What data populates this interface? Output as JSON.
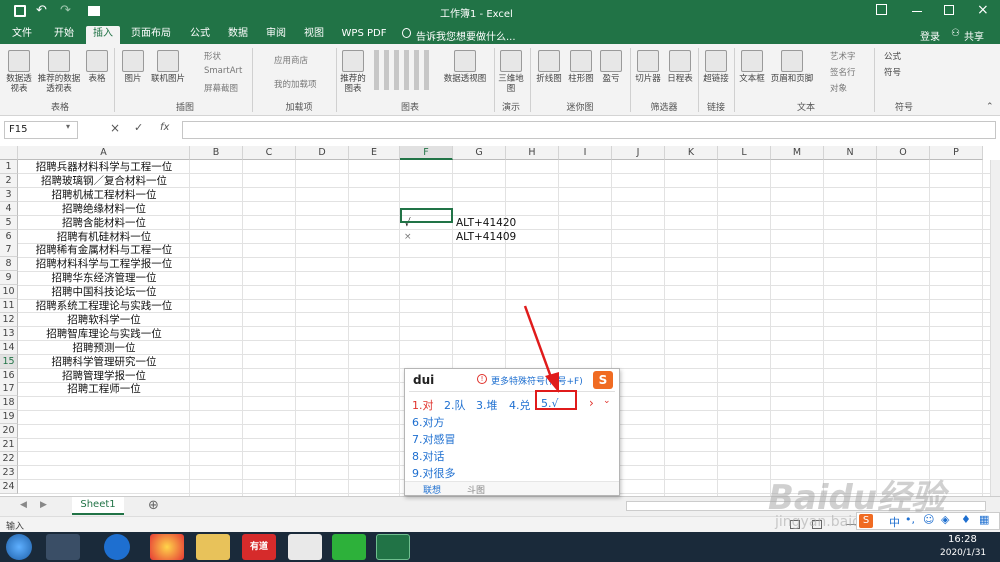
{
  "window": {
    "title": "工作簿1 - Excel"
  },
  "tabs": [
    "文件",
    "开始",
    "插入",
    "页面布局",
    "公式",
    "数据",
    "审阅",
    "视图",
    "WPS PDF"
  ],
  "active_tab": "插入",
  "tellme": "告诉我您想要做什么...",
  "account": {
    "login": "登录",
    "share": "共享"
  },
  "ribbon": {
    "groups": [
      {
        "label": "表格",
        "buttons": [
          "数据透视表",
          "推荐的数据透视表",
          "表格"
        ]
      },
      {
        "label": "插图",
        "buttons": [
          "图片",
          "联机图片"
        ],
        "small": [
          "形状",
          "SmartArt",
          "屏幕截图"
        ]
      },
      {
        "label": "加载项",
        "small": [
          "应用商店",
          "我的加载项"
        ]
      },
      {
        "label": "图表",
        "buttons": [
          "推荐的图表",
          "数据透视图"
        ]
      },
      {
        "label": "演示",
        "buttons": [
          "三维地图"
        ]
      },
      {
        "label": "迷你图",
        "buttons": [
          "折线图",
          "柱形图",
          "盈亏"
        ]
      },
      {
        "label": "筛选器",
        "buttons": [
          "切片器",
          "日程表"
        ]
      },
      {
        "label": "链接",
        "buttons": [
          "超链接"
        ]
      },
      {
        "label": "文本",
        "buttons": [
          "文本框",
          "页眉和页脚"
        ],
        "small": [
          "艺术字",
          "签名行",
          "对象"
        ]
      },
      {
        "label": "符号",
        "small": [
          "公式",
          "符号"
        ]
      }
    ]
  },
  "formula_bar": {
    "name_box": "F15",
    "fx": "fx",
    "value": ""
  },
  "columns": [
    "A",
    "B",
    "C",
    "D",
    "E",
    "F",
    "G",
    "H",
    "I",
    "J",
    "K",
    "L",
    "M",
    "N",
    "O",
    "P"
  ],
  "rows": [
    "1",
    "2",
    "3",
    "4",
    "5",
    "6",
    "7",
    "8",
    "9",
    "10",
    "11",
    "12",
    "13",
    "14",
    "15",
    "16",
    "17",
    "18",
    "19",
    "20",
    "21",
    "22",
    "23",
    "24"
  ],
  "col_a": [
    "招聘兵器材料科学与工程一位",
    "招聘玻璃钢／复合材料一位",
    "招聘机械工程材料一位",
    "招聘绝缘材料一位",
    "招聘含能材料一位",
    "招聘有机硅材料一位",
    "招聘稀有金属材料与工程一位",
    "招聘材料科学与工程学报一位",
    "招聘华东经济管理一位",
    "招聘中国科技论坛一位",
    "招聘系统工程理论与实践一位",
    "招聘软科学一位",
    "招聘智库理论与实践一位",
    "招聘预测一位",
    "招聘科学管理研究一位",
    "招聘管理学报一位",
    "招聘工程师一位"
  ],
  "cells": {
    "F5": "√",
    "G5": "ALT+41420",
    "F6": "×",
    "G6": "ALT+41409"
  },
  "sheet_tab": "Sheet1",
  "status": "输入",
  "ime": {
    "input": "dui",
    "more": "更多特殊符号(符号+F)",
    "candidates": [
      "1.对",
      "2.队",
      "3.堆",
      "4.兑",
      "5.√"
    ],
    "more_candidates": [
      "6.对方",
      "7.对感冒",
      "8.对话",
      "9.对很多"
    ],
    "bottom_tabs": [
      "联想",
      "斗图"
    ]
  },
  "taskbar": {
    "apps": [
      "有道"
    ],
    "time": "16:28",
    "date": "2020/1/31",
    "ime_lang": "中"
  },
  "watermark": "Baidu经验",
  "watermark_sub": "jingyan.baidu.com",
  "colors": {
    "excel_green": "#217346",
    "red_arrow": "#e01b1b"
  }
}
